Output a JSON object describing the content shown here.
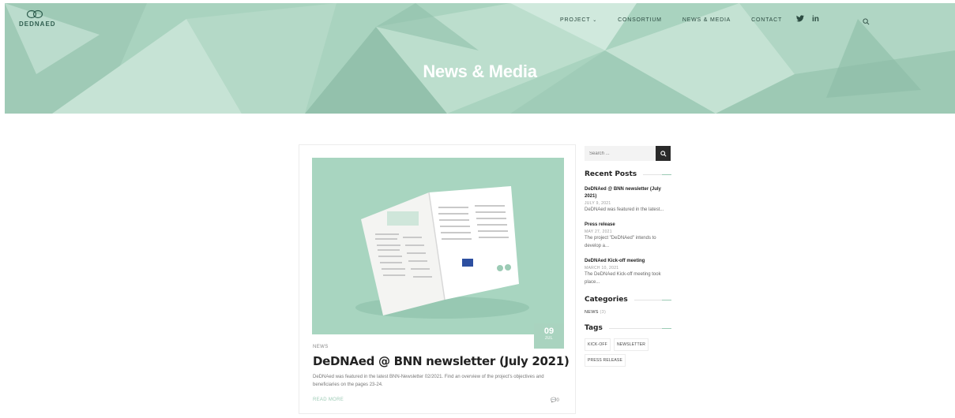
{
  "header": {
    "logo_text": "DEDNAED",
    "nav": [
      {
        "label": "PROJECT",
        "has_dropdown": true
      },
      {
        "label": "CONSORTIUM"
      },
      {
        "label": "NEWS & MEDIA"
      },
      {
        "label": "CONTACT"
      }
    ],
    "social": {
      "twitter": "twitter-icon",
      "linkedin_label": "in"
    },
    "search_icon": "search-icon"
  },
  "hero": {
    "title": "News & Media"
  },
  "post": {
    "date_day": "09",
    "date_month": "JUL",
    "category": "NEWS",
    "title": "DeDNAed @ BNN newsletter (July 2021)",
    "excerpt": "DeDNAed was featured in the latest BNN-Newsletter 02/2021. Find an overview of the project's objectives and beneficiaries on the pages 23-24.",
    "read_more": "READ MORE",
    "comments": "0"
  },
  "sidebar": {
    "search_placeholder": "Search ...",
    "recent_posts_title": "Recent Posts",
    "recent_posts": [
      {
        "title": "DeDNAed @ BNN newsletter (July 2021)",
        "date": "JULY 9, 2021",
        "excerpt": "DeDNAed was featured in the latest..."
      },
      {
        "title": "Press release",
        "date": "MAY 27, 2021",
        "excerpt": "The project \"DeDNAed\" intends to develop a..."
      },
      {
        "title": "DeDNAed Kick-off meeting",
        "date": "MARCH 10, 2021",
        "excerpt": "The DeDNAed Kick-off meeting took place..."
      }
    ],
    "categories_title": "Categories",
    "categories": [
      {
        "name": "NEWS",
        "count": "(3)"
      }
    ],
    "tags_title": "Tags",
    "tags": [
      "KICK-OFF",
      "NEWSLETTER",
      "PRESS RELEASE"
    ]
  },
  "colors": {
    "accent": "#9ccbb5",
    "hero": "#a9d3bf",
    "dark": "#2a2a2a"
  }
}
